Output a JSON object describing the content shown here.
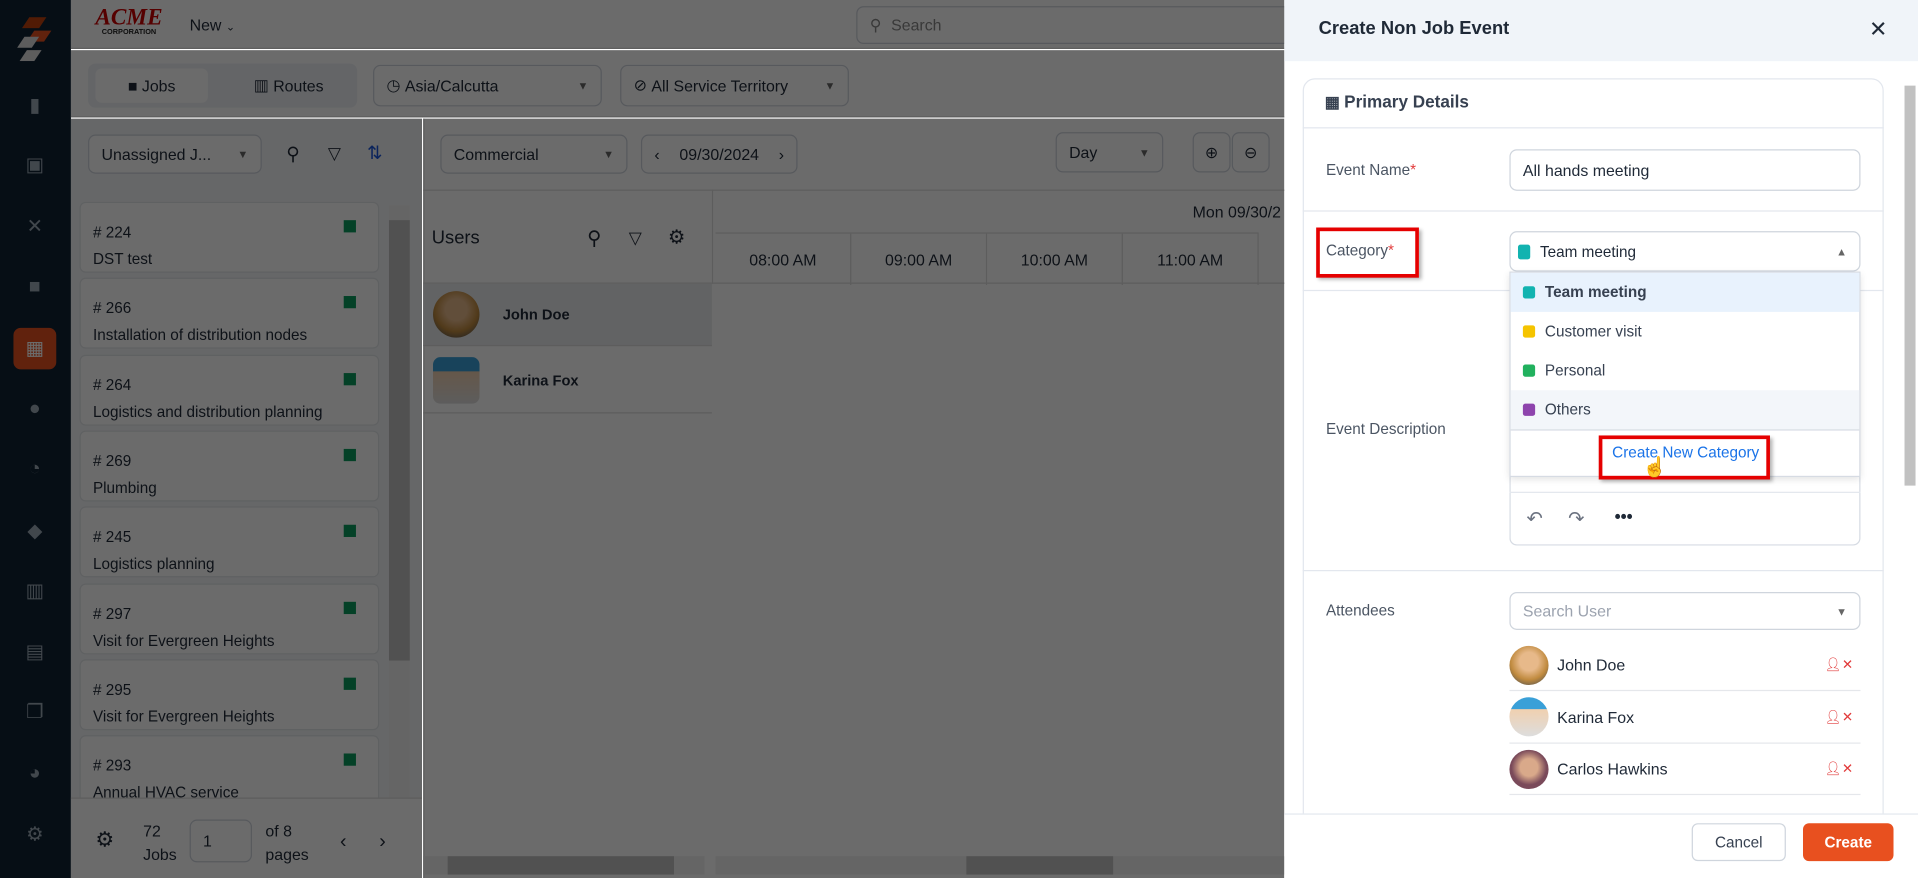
{
  "sidebar": {
    "icons": [
      "logo-icon",
      "chart-icon",
      "clipboard-icon",
      "tools-icon",
      "briefcase-icon",
      "calendar-icon",
      "users-icon",
      "clock-icon",
      "tag-icon",
      "map-icon",
      "calculator-icon",
      "documents-icon",
      "pie-chart-icon",
      "settings-icon"
    ],
    "active": "calendar-icon"
  },
  "header": {
    "logo_top": "ACME",
    "logo_bottom": "CORPORATION",
    "new_label": "New",
    "search_placeholder": "Search"
  },
  "toolbar": {
    "jobs": "Jobs",
    "routes": "Routes",
    "timezone": "Asia/Calcutta",
    "territory": "All Service Territory",
    "job_filter": "Unassigned J...",
    "business_type": "Commercial",
    "date": "09/30/2024",
    "view": "Day"
  },
  "jobs": [
    {
      "id": "# 224",
      "title": "DST test"
    },
    {
      "id": "# 266",
      "title": "Installation of distribution nodes"
    },
    {
      "id": "# 264",
      "title": "Logistics and distribution planning"
    },
    {
      "id": "# 269",
      "title": "Plumbing"
    },
    {
      "id": "# 245",
      "title": "Logistics planning"
    },
    {
      "id": "# 297",
      "title": "Visit for Evergreen Heights"
    },
    {
      "id": "# 295",
      "title": "Visit for Evergreen Heights"
    },
    {
      "id": "# 293",
      "title": "Annual HVAC service"
    }
  ],
  "pagination": {
    "count": "72",
    "count_label": "Jobs",
    "page": "1",
    "of": "of 8",
    "pages_label": "pages"
  },
  "scheduler": {
    "users_title": "Users",
    "day_header": "Mon 09/30/2",
    "times": [
      "08:00 AM",
      "09:00 AM",
      "10:00 AM",
      "11:00 AM"
    ],
    "users": [
      "John Doe",
      "Karina Fox"
    ]
  },
  "panel": {
    "title": "Create Non Job Event",
    "section": "Primary Details",
    "event_name_label": "Event Name",
    "event_name": "All hands meeting",
    "required": "*",
    "category_label": "Category",
    "category_value": "Team meeting",
    "categories": [
      {
        "label": "Team meeting",
        "color": "#12b3b0"
      },
      {
        "label": "Customer visit",
        "color": "#f5c400"
      },
      {
        "label": "Personal",
        "color": "#21b15e"
      },
      {
        "label": "Others",
        "color": "#8e44ad"
      }
    ],
    "create_category": "Create New Category",
    "description_label": "Event Description",
    "attendees_label": "Attendees",
    "attendee_placeholder": "Search User",
    "attendees": [
      "John Doe",
      "Karina Fox",
      "Carlos Hawkins"
    ],
    "cancel": "Cancel",
    "create": "Create"
  },
  "colors": {
    "accent": "#e8501f",
    "link": "#1a73e8"
  }
}
